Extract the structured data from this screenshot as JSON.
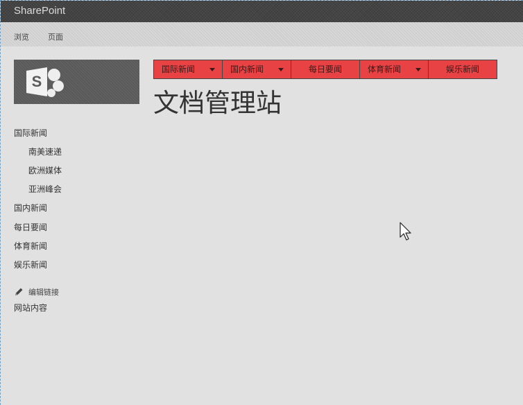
{
  "suite_bar": {
    "title": "SharePoint"
  },
  "ribbon": {
    "tabs": [
      "浏览",
      "页面"
    ]
  },
  "top_nav": {
    "items": [
      {
        "label": "国际新闻",
        "has_dropdown": true
      },
      {
        "label": "国内新闻",
        "has_dropdown": true
      },
      {
        "label": "每日要闻",
        "has_dropdown": false
      },
      {
        "label": "体育新闻",
        "has_dropdown": true
      },
      {
        "label": "娱乐新闻",
        "has_dropdown": false
      }
    ]
  },
  "page_title": "文档管理站",
  "left_nav": {
    "items": [
      {
        "label": "国际新闻",
        "level": 0
      },
      {
        "label": "南美速递",
        "level": 1
      },
      {
        "label": "欧洲媒体",
        "level": 1
      },
      {
        "label": "亚洲峰会",
        "level": 1
      },
      {
        "label": "国内新闻",
        "level": 0
      },
      {
        "label": "每日要闻",
        "level": 0
      },
      {
        "label": "体育新闻",
        "level": 0
      },
      {
        "label": "娱乐新闻",
        "level": 0
      }
    ],
    "edit_links_label": "编辑链接",
    "site_contents_label": "网站内容"
  },
  "icons": {
    "logo": "sharepoint-logo-icon",
    "edit": "pencil-icon",
    "cursor": "mouse-pointer-icon",
    "dropdown": "chevron-down-icon"
  },
  "colors": {
    "nav_red": "#e84244",
    "suite_bar": "#444444",
    "background": "#e1e1e1"
  }
}
